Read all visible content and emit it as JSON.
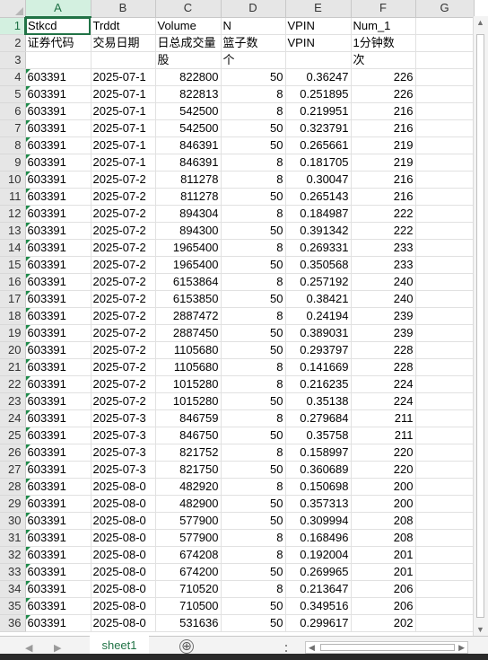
{
  "columns": [
    "A",
    "B",
    "C",
    "D",
    "E",
    "F",
    "G"
  ],
  "rows": [
    [
      "Stkcd",
      "Trddt",
      "Volume",
      "N",
      "VPIN",
      "Num_1",
      ""
    ],
    [
      "证券代码",
      "交易日期",
      "日总成交量",
      "篮子数",
      "VPIN",
      "1分钟数",
      ""
    ],
    [
      "",
      "",
      "股",
      "个",
      "",
      "次",
      ""
    ],
    [
      "603391",
      "2025-07-1",
      "822800",
      "50",
      "0.36247",
      "226",
      ""
    ],
    [
      "603391",
      "2025-07-1",
      "822813",
      "8",
      "0.251895",
      "226",
      ""
    ],
    [
      "603391",
      "2025-07-1",
      "542500",
      "8",
      "0.219951",
      "216",
      ""
    ],
    [
      "603391",
      "2025-07-1",
      "542500",
      "50",
      "0.323791",
      "216",
      ""
    ],
    [
      "603391",
      "2025-07-1",
      "846391",
      "50",
      "0.265661",
      "219",
      ""
    ],
    [
      "603391",
      "2025-07-1",
      "846391",
      "8",
      "0.181705",
      "219",
      ""
    ],
    [
      "603391",
      "2025-07-2",
      "811278",
      "8",
      "0.30047",
      "216",
      ""
    ],
    [
      "603391",
      "2025-07-2",
      "811278",
      "50",
      "0.265143",
      "216",
      ""
    ],
    [
      "603391",
      "2025-07-2",
      "894304",
      "8",
      "0.184987",
      "222",
      ""
    ],
    [
      "603391",
      "2025-07-2",
      "894300",
      "50",
      "0.391342",
      "222",
      ""
    ],
    [
      "603391",
      "2025-07-2",
      "1965400",
      "8",
      "0.269331",
      "233",
      ""
    ],
    [
      "603391",
      "2025-07-2",
      "1965400",
      "50",
      "0.350568",
      "233",
      ""
    ],
    [
      "603391",
      "2025-07-2",
      "6153864",
      "8",
      "0.257192",
      "240",
      ""
    ],
    [
      "603391",
      "2025-07-2",
      "6153850",
      "50",
      "0.38421",
      "240",
      ""
    ],
    [
      "603391",
      "2025-07-2",
      "2887472",
      "8",
      "0.24194",
      "239",
      ""
    ],
    [
      "603391",
      "2025-07-2",
      "2887450",
      "50",
      "0.389031",
      "239",
      ""
    ],
    [
      "603391",
      "2025-07-2",
      "1105680",
      "50",
      "0.293797",
      "228",
      ""
    ],
    [
      "603391",
      "2025-07-2",
      "1105680",
      "8",
      "0.141669",
      "228",
      ""
    ],
    [
      "603391",
      "2025-07-2",
      "1015280",
      "8",
      "0.216235",
      "224",
      ""
    ],
    [
      "603391",
      "2025-07-2",
      "1015280",
      "50",
      "0.35138",
      "224",
      ""
    ],
    [
      "603391",
      "2025-07-3",
      "846759",
      "8",
      "0.279684",
      "211",
      ""
    ],
    [
      "603391",
      "2025-07-3",
      "846750",
      "50",
      "0.35758",
      "211",
      ""
    ],
    [
      "603391",
      "2025-07-3",
      "821752",
      "8",
      "0.158997",
      "220",
      ""
    ],
    [
      "603391",
      "2025-07-3",
      "821750",
      "50",
      "0.360689",
      "220",
      ""
    ],
    [
      "603391",
      "2025-08-0",
      "482920",
      "8",
      "0.150698",
      "200",
      ""
    ],
    [
      "603391",
      "2025-08-0",
      "482900",
      "50",
      "0.357313",
      "200",
      ""
    ],
    [
      "603391",
      "2025-08-0",
      "577900",
      "50",
      "0.309994",
      "208",
      ""
    ],
    [
      "603391",
      "2025-08-0",
      "577900",
      "8",
      "0.168496",
      "208",
      ""
    ],
    [
      "603391",
      "2025-08-0",
      "674208",
      "8",
      "0.192004",
      "201",
      ""
    ],
    [
      "603391",
      "2025-08-0",
      "674200",
      "50",
      "0.269965",
      "201",
      ""
    ],
    [
      "603391",
      "2025-08-0",
      "710520",
      "8",
      "0.213647",
      "206",
      ""
    ],
    [
      "603391",
      "2025-08-0",
      "710500",
      "50",
      "0.349516",
      "206",
      ""
    ],
    [
      "603391",
      "2025-08-0",
      "531636",
      "50",
      "0.299617",
      "202",
      ""
    ]
  ],
  "sheet_tab": "sheet1",
  "add_sheet_symbol": "⊕",
  "active_cell": "A1",
  "colors": {
    "accent": "#217346",
    "selected_header_bg": "#d3f0e0",
    "grid": "#e1e1e1",
    "header_bg": "#e6e6e6"
  },
  "icons": [
    "add-sheet-icon",
    "scroll-left-icon",
    "scroll-right-icon",
    "scroll-up-icon",
    "scroll-down-icon"
  ]
}
